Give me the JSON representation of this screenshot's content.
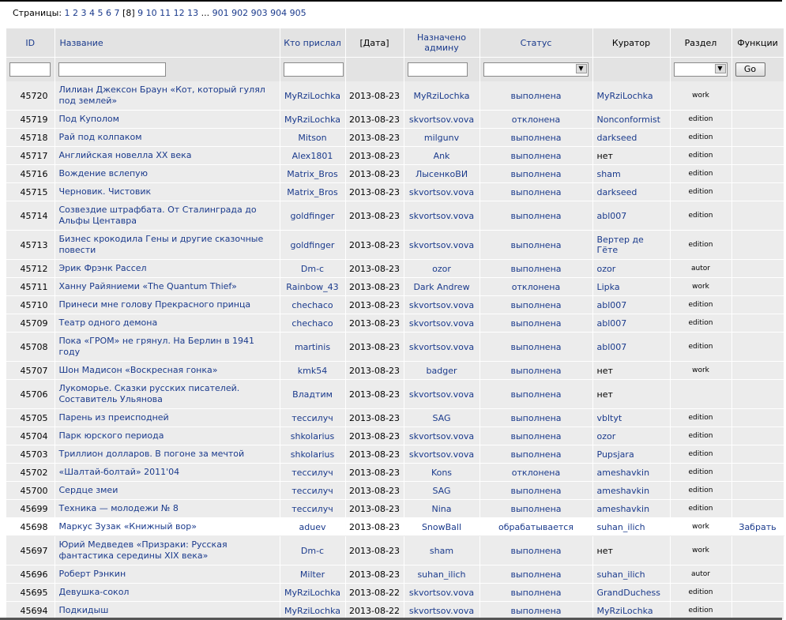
{
  "pager": {
    "label": "Страницы:",
    "pages_before": [
      "1",
      "2",
      "3",
      "4",
      "5",
      "6",
      "7"
    ],
    "current": "[8]",
    "pages_after": [
      "9",
      "10",
      "11",
      "12",
      "13"
    ],
    "ellipsis": "...",
    "pages_end": [
      "901",
      "902",
      "903",
      "904",
      "905"
    ]
  },
  "table": {
    "headers": {
      "id": "ID",
      "title": "Название",
      "sender": "Кто прислал",
      "date": "[Дата]",
      "assigned": "Назначено админу",
      "status": "Статус",
      "curator": "Куратор",
      "section": "Раздел",
      "functions": "Функции"
    },
    "filter": {
      "go_label": "Go"
    },
    "rows": [
      {
        "id": "45720",
        "title": "Лилиан Джексон Браун «Кот, который гулял под землей»",
        "sender": "MyRziLochka",
        "date": "2013-08-23",
        "assigned": "MyRziLochka",
        "status": "выполнена",
        "status_type": "done",
        "curator": "MyRziLochka",
        "section": "work",
        "fn": "",
        "tall": true,
        "hl": false
      },
      {
        "id": "45719",
        "title": "Под Куполом",
        "sender": "MyRziLochka",
        "date": "2013-08-23",
        "assigned": "skvortsov.vova",
        "status": "отклонена",
        "status_type": "rej",
        "curator": "Nonconformist",
        "section": "edition",
        "fn": "",
        "tall": false,
        "hl": false
      },
      {
        "id": "45718",
        "title": "Рай под колпаком",
        "sender": "Mitson",
        "date": "2013-08-23",
        "assigned": "milgunv",
        "status": "выполнена",
        "status_type": "done",
        "curator": "darkseed",
        "section": "edition",
        "fn": "",
        "tall": false,
        "hl": false
      },
      {
        "id": "45717",
        "title": "Английская новелла XX века",
        "sender": "Alex1801",
        "date": "2013-08-23",
        "assigned": "Ank",
        "status": "выполнена",
        "status_type": "done",
        "curator": "нет",
        "section": "edition",
        "fn": "",
        "tall": false,
        "hl": false
      },
      {
        "id": "45716",
        "title": "Вождение вслепую",
        "sender": "Matrix_Bros",
        "date": "2013-08-23",
        "assigned": "ЛысенкоВИ",
        "status": "выполнена",
        "status_type": "done",
        "curator": "sham",
        "section": "edition",
        "fn": "",
        "tall": false,
        "hl": false
      },
      {
        "id": "45715",
        "title": "Черновик. Чистовик",
        "sender": "Matrix_Bros",
        "date": "2013-08-23",
        "assigned": "skvortsov.vova",
        "status": "выполнена",
        "status_type": "done",
        "curator": "darkseed",
        "section": "edition",
        "fn": "",
        "tall": false,
        "hl": false
      },
      {
        "id": "45714",
        "title": "Созвездие штрафбата. От Сталинграда до Альфы Центавра",
        "sender": "goldfinger",
        "date": "2013-08-23",
        "assigned": "skvortsov.vova",
        "status": "выполнена",
        "status_type": "done",
        "curator": "abl007",
        "section": "edition",
        "fn": "",
        "tall": true,
        "hl": false
      },
      {
        "id": "45713",
        "title": "Бизнес крокодила Гены и другие сказочные повести",
        "sender": "goldfinger",
        "date": "2013-08-23",
        "assigned": "skvortsov.vova",
        "status": "выполнена",
        "status_type": "done",
        "curator": "Вертер де Гёте",
        "section": "edition",
        "fn": "",
        "tall": true,
        "hl": false
      },
      {
        "id": "45712",
        "title": "Эрик Фрэнк Рассел",
        "sender": "Dm-c",
        "date": "2013-08-23",
        "assigned": "ozor",
        "status": "выполнена",
        "status_type": "done",
        "curator": "ozor",
        "section": "autor",
        "fn": "",
        "tall": false,
        "hl": false
      },
      {
        "id": "45711",
        "title": "Ханну Райяниеми «The Quantum Thief»",
        "sender": "Rainbow_43",
        "date": "2013-08-23",
        "assigned": "Dark Andrew",
        "status": "отклонена",
        "status_type": "rej",
        "curator": "Lipka",
        "section": "work",
        "fn": "",
        "tall": false,
        "hl": false
      },
      {
        "id": "45710",
        "title": "Принеси мне голову Прекрасного принца",
        "sender": "chechaco",
        "date": "2013-08-23",
        "assigned": "skvortsov.vova",
        "status": "выполнена",
        "status_type": "done",
        "curator": "abl007",
        "section": "edition",
        "fn": "",
        "tall": false,
        "hl": false
      },
      {
        "id": "45709",
        "title": "Театр одного демона",
        "sender": "chechaco",
        "date": "2013-08-23",
        "assigned": "skvortsov.vova",
        "status": "выполнена",
        "status_type": "done",
        "curator": "abl007",
        "section": "edition",
        "fn": "",
        "tall": false,
        "hl": false
      },
      {
        "id": "45708",
        "title": "Пока «ГРОМ» не грянул. На Берлин в 1941 году",
        "sender": "martinis",
        "date": "2013-08-23",
        "assigned": "skvortsov.vova",
        "status": "выполнена",
        "status_type": "done",
        "curator": "abl007",
        "section": "edition",
        "fn": "",
        "tall": true,
        "hl": false
      },
      {
        "id": "45707",
        "title": "Шон Мадисон «Воскресная гонка»",
        "sender": "kmk54",
        "date": "2013-08-23",
        "assigned": "badger",
        "status": "выполнена",
        "status_type": "done",
        "curator": "нет",
        "section": "work",
        "fn": "",
        "tall": false,
        "hl": false
      },
      {
        "id": "45706",
        "title": "Лукоморье. Сказки русских писателей. Составитель Ульянова",
        "sender": "Владтим",
        "date": "2013-08-23",
        "assigned": "skvortsov.vova",
        "status": "выполнена",
        "status_type": "done",
        "curator": "нет",
        "section": "",
        "fn": "",
        "tall": true,
        "hl": false
      },
      {
        "id": "45705",
        "title": "Парень из преисподней",
        "sender": "тессилуч",
        "date": "2013-08-23",
        "assigned": "SAG",
        "status": "выполнена",
        "status_type": "done",
        "curator": "vbltyt",
        "section": "edition",
        "fn": "",
        "tall": false,
        "hl": false
      },
      {
        "id": "45704",
        "title": "Парк юрского периода",
        "sender": "shkolarius",
        "date": "2013-08-23",
        "assigned": "skvortsov.vova",
        "status": "выполнена",
        "status_type": "done",
        "curator": "ozor",
        "section": "edition",
        "fn": "",
        "tall": false,
        "hl": false
      },
      {
        "id": "45703",
        "title": "Триллион долларов. В погоне за мечтой",
        "sender": "shkolarius",
        "date": "2013-08-23",
        "assigned": "skvortsov.vova",
        "status": "выполнена",
        "status_type": "done",
        "curator": "Pupsjara",
        "section": "edition",
        "fn": "",
        "tall": false,
        "hl": false
      },
      {
        "id": "45702",
        "title": "«Шалтай-болтай» 2011'04",
        "sender": "тессилуч",
        "date": "2013-08-23",
        "assigned": "Kons",
        "status": "отклонена",
        "status_type": "rej",
        "curator": "ameshavkin",
        "section": "edition",
        "fn": "",
        "tall": false,
        "hl": false
      },
      {
        "id": "45700",
        "title": "Сердце змеи",
        "sender": "тессилуч",
        "date": "2013-08-23",
        "assigned": "SAG",
        "status": "выполнена",
        "status_type": "done",
        "curator": "ameshavkin",
        "section": "edition",
        "fn": "",
        "tall": false,
        "hl": false
      },
      {
        "id": "45699",
        "title": "Техника — молодежи № 8",
        "sender": "тессилуч",
        "date": "2013-08-23",
        "assigned": "Nina",
        "status": "выполнена",
        "status_type": "done",
        "curator": "ameshavkin",
        "section": "edition",
        "fn": "",
        "tall": false,
        "hl": false
      },
      {
        "id": "45698",
        "title": "Маркус Зузак «Книжный вор»",
        "sender": "aduev",
        "date": "2013-08-23",
        "assigned": "SnowBall",
        "status": "обрабатывается",
        "status_type": "proc",
        "curator": "suhan_ilich",
        "section": "work",
        "fn": "Забрать",
        "tall": false,
        "hl": true
      },
      {
        "id": "45697",
        "title": "Юрий Медведев «Призраки: Русская фантастика середины XIX века»",
        "sender": "Dm-c",
        "date": "2013-08-23",
        "assigned": "sham",
        "status": "выполнена",
        "status_type": "done",
        "curator": "нет",
        "section": "work",
        "fn": "",
        "tall": true,
        "hl": false
      },
      {
        "id": "45696",
        "title": "Роберт Рэнкин",
        "sender": "Milter",
        "date": "2013-08-23",
        "assigned": "suhan_ilich",
        "status": "выполнена",
        "status_type": "done",
        "curator": "suhan_ilich",
        "section": "autor",
        "fn": "",
        "tall": false,
        "hl": false
      },
      {
        "id": "45695",
        "title": "Девушка-сокол",
        "sender": "MyRziLochka",
        "date": "2013-08-22",
        "assigned": "skvortsov.vova",
        "status": "выполнена",
        "status_type": "done",
        "curator": "GrandDuchess",
        "section": "edition",
        "fn": "",
        "tall": false,
        "hl": false
      },
      {
        "id": "45694",
        "title": "Подкидыш",
        "sender": "MyRziLochka",
        "date": "2013-08-22",
        "assigned": "skvortsov.vova",
        "status": "выполнена",
        "status_type": "done",
        "curator": "MyRziLochka",
        "section": "edition",
        "fn": "",
        "tall": false,
        "hl": false
      }
    ]
  },
  "colors": {
    "link": "#1a3a8c",
    "done": "#00a000",
    "rejected": "#cc0000",
    "processing": "#e0a000",
    "row_bg": "#ececec",
    "header_bg": "#e3e3e3"
  }
}
